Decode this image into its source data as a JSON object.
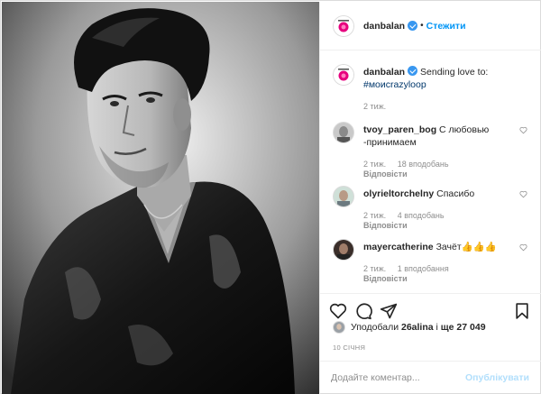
{
  "post": {
    "author": "danbalan",
    "follow_label": "Стежити",
    "separator": "•",
    "photo_alt": "danbalan portrait"
  },
  "caption": {
    "author": "danbalan",
    "text": "Sending love to:",
    "hashtag": "#моиcrazyloop",
    "time": "2 тиж."
  },
  "comments": [
    {
      "user": "tvoy_paren_bog",
      "text": "С любовью -принимаем",
      "time": "2 тиж.",
      "likes": "18 вподобань",
      "reply": "Відповісти"
    },
    {
      "user": "olyrieltorchelny",
      "text": "Спасибо",
      "time": "2 тиж.",
      "likes": "4 вподобань",
      "reply": "Відповісти"
    },
    {
      "user": "mayercatherine",
      "text": "Зачёт👍👍👍",
      "time": "2 тиж.",
      "likes": "1 вподобання",
      "reply": "Відповісти"
    }
  ],
  "likes": {
    "prefix": "Уподобали",
    "first": "26alina",
    "middle": "і",
    "rest": "ще 27 049"
  },
  "date": "10 СІЧНЯ",
  "add_comment": {
    "placeholder": "Додайте коментар...",
    "submit_label": "Опублікувати"
  },
  "colors": {
    "accent": "#0095f6",
    "submit_disabled": "#b2dffc",
    "muted": "#8e8e8e",
    "text": "#262626",
    "verified": "#3897f0",
    "avatar_logo": "#e6007e"
  },
  "icons": [
    "verified-badge-icon",
    "heart-icon",
    "comment-icon",
    "share-icon",
    "bookmark-icon",
    "small-heart-icon"
  ]
}
